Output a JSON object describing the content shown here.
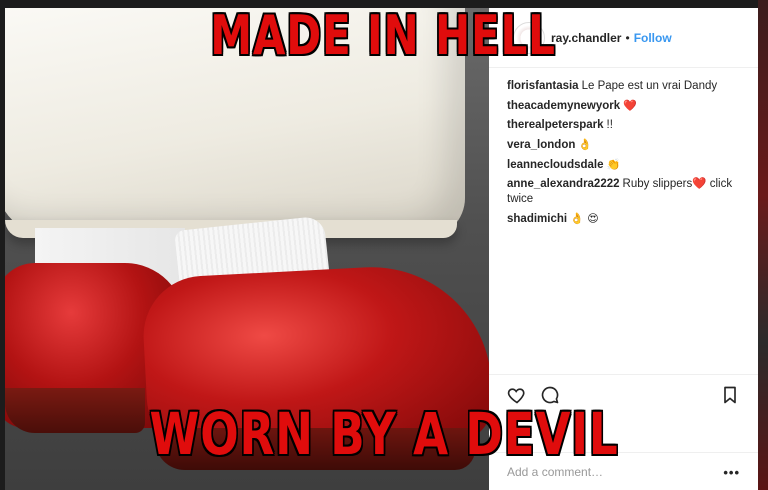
{
  "post": {
    "username": "ray.chandler",
    "separator": "•",
    "follow_label": "Follow"
  },
  "meme": {
    "top_text": "MADE IN HELL",
    "bottom_text": "WORN BY A DEVIL"
  },
  "comments": [
    {
      "user": "florisfantasia",
      "text": "Le Pape est un vrai Dandy",
      "emoji": ""
    },
    {
      "user": "theacademynewyork",
      "text": "",
      "emoji": "❤️"
    },
    {
      "user": "therealpeterspark",
      "text": "!!",
      "emoji": ""
    },
    {
      "user": "vera_london",
      "text": "",
      "emoji": "👌"
    },
    {
      "user": "leanneclouds​dale",
      "text": "",
      "emoji": "👏"
    },
    {
      "user": "anne_alexandra2222",
      "text": "Ruby slippers❤️  click twice",
      "emoji": ""
    },
    {
      "user": "shadimichi",
      "text": "",
      "emoji": "👌 😍"
    }
  ],
  "add_comment": {
    "placeholder": "Add a comment…",
    "more_label": "•••"
  },
  "icons": {
    "like": "heart-icon",
    "comment": "comment-icon",
    "save": "bookmark-icon",
    "more": "more-icon"
  },
  "colors": {
    "meme_red": "#e00c0c",
    "link_blue": "#3897f0",
    "text": "#262626"
  }
}
